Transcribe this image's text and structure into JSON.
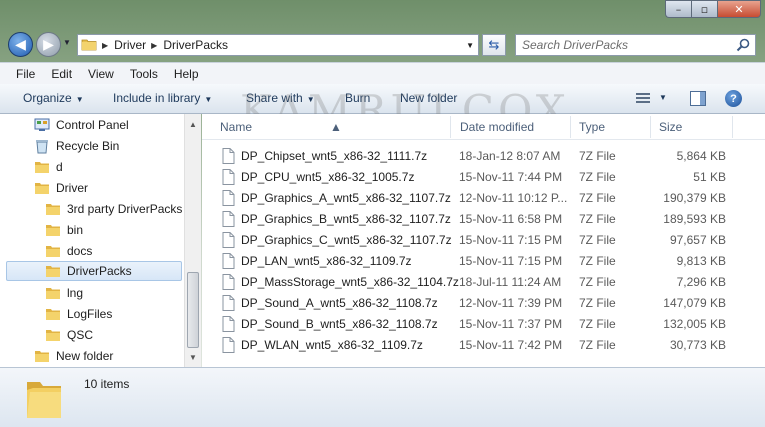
{
  "window": {
    "controls": {
      "minimize": "–",
      "maximize": "▫",
      "close": "✕"
    }
  },
  "address": {
    "segments": [
      "Driver",
      "DriverPacks"
    ],
    "search_placeholder": "Search DriverPacks"
  },
  "menu": [
    "File",
    "Edit",
    "View",
    "Tools",
    "Help"
  ],
  "commands": {
    "organize": "Organize",
    "include_in_library": "Include in library",
    "share_with": "Share with",
    "burn": "Burn",
    "new_folder": "New folder"
  },
  "watermark": "KAMRULCOX",
  "nav": [
    {
      "label": "Control Panel",
      "icon": "control-panel-icon"
    },
    {
      "label": "Recycle Bin",
      "icon": "recycle-bin-icon"
    },
    {
      "label": "d",
      "icon": "folder-icon"
    },
    {
      "label": "Driver",
      "icon": "folder-icon"
    },
    {
      "label": "3rd party DriverPacks",
      "icon": "folder-icon"
    },
    {
      "label": "bin",
      "icon": "folder-icon"
    },
    {
      "label": "docs",
      "icon": "folder-icon"
    },
    {
      "label": "DriverPacks",
      "icon": "folder-icon",
      "selected": true
    },
    {
      "label": "lng",
      "icon": "folder-icon"
    },
    {
      "label": "LogFiles",
      "icon": "folder-icon"
    },
    {
      "label": "QSC",
      "icon": "folder-icon"
    },
    {
      "label": "New folder",
      "icon": "folder-icon"
    }
  ],
  "columns": {
    "name": "Name",
    "date": "Date modified",
    "type": "Type",
    "size": "Size"
  },
  "files": [
    {
      "name": "DP_Chipset_wnt5_x86-32_1111.7z",
      "date": "18-Jan-12 8:07 AM",
      "type": "7Z File",
      "size": "5,864 KB"
    },
    {
      "name": "DP_CPU_wnt5_x86-32_1005.7z",
      "date": "15-Nov-11 7:44 PM",
      "type": "7Z File",
      "size": "51 KB"
    },
    {
      "name": "DP_Graphics_A_wnt5_x86-32_1107.7z",
      "date": "12-Nov-11 10:12 P...",
      "type": "7Z File",
      "size": "190,379 KB"
    },
    {
      "name": "DP_Graphics_B_wnt5_x86-32_1107.7z",
      "date": "15-Nov-11 6:58 PM",
      "type": "7Z File",
      "size": "189,593 KB"
    },
    {
      "name": "DP_Graphics_C_wnt5_x86-32_1107.7z",
      "date": "15-Nov-11 7:15 PM",
      "type": "7Z File",
      "size": "97,657 KB"
    },
    {
      "name": "DP_LAN_wnt5_x86-32_1109.7z",
      "date": "15-Nov-11 7:15 PM",
      "type": "7Z File",
      "size": "9,813 KB"
    },
    {
      "name": "DP_MassStorage_wnt5_x86-32_1104.7z",
      "date": "18-Jul-11 11:24 AM",
      "type": "7Z File",
      "size": "7,296 KB"
    },
    {
      "name": "DP_Sound_A_wnt5_x86-32_1108.7z",
      "date": "12-Nov-11 7:39 PM",
      "type": "7Z File",
      "size": "147,079 KB"
    },
    {
      "name": "DP_Sound_B_wnt5_x86-32_1108.7z",
      "date": "15-Nov-11 7:37 PM",
      "type": "7Z File",
      "size": "132,005 KB"
    },
    {
      "name": "DP_WLAN_wnt5_x86-32_1109.7z",
      "date": "15-Nov-11 7:42 PM",
      "type": "7Z File",
      "size": "30,773 KB"
    }
  ],
  "details": {
    "item_count": "10 items"
  }
}
